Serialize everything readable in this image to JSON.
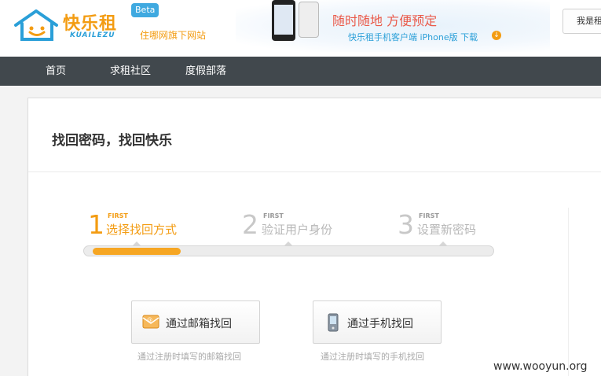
{
  "header": {
    "logo_text": "快乐租",
    "logo_sub": "KUAILEZU",
    "beta": "Beta",
    "slogan": "住哪网旗下网站",
    "banner_title": "随时随地 方便预定",
    "banner_sub": "快乐租手机客户端 iPhone版 下载",
    "top_button": "我是租客"
  },
  "nav": {
    "items": [
      "首页",
      "求租社区",
      "度假部落"
    ]
  },
  "main": {
    "title": "找回密码，找回快乐",
    "steps": [
      {
        "num": "1",
        "tag": "FIRST",
        "label": "选择找回方式"
      },
      {
        "num": "2",
        "tag": "FIRST",
        "label": "验证用户身份"
      },
      {
        "num": "3",
        "tag": "FIRST",
        "label": "设置新密码"
      }
    ],
    "progress_fraction": 0.21,
    "options": [
      {
        "label": "通过邮箱找回",
        "hint": "通过注册时填写的邮箱找回",
        "icon": "email-icon"
      },
      {
        "label": "通过手机找回",
        "hint": "通过注册时填写的手机找回",
        "icon": "mobile-phone-icon"
      }
    ]
  },
  "watermark": "www.wooyun.org",
  "colors": {
    "accent": "#f39c12",
    "nav_bg": "#41484d",
    "brand_blue": "#2a9fd8"
  }
}
